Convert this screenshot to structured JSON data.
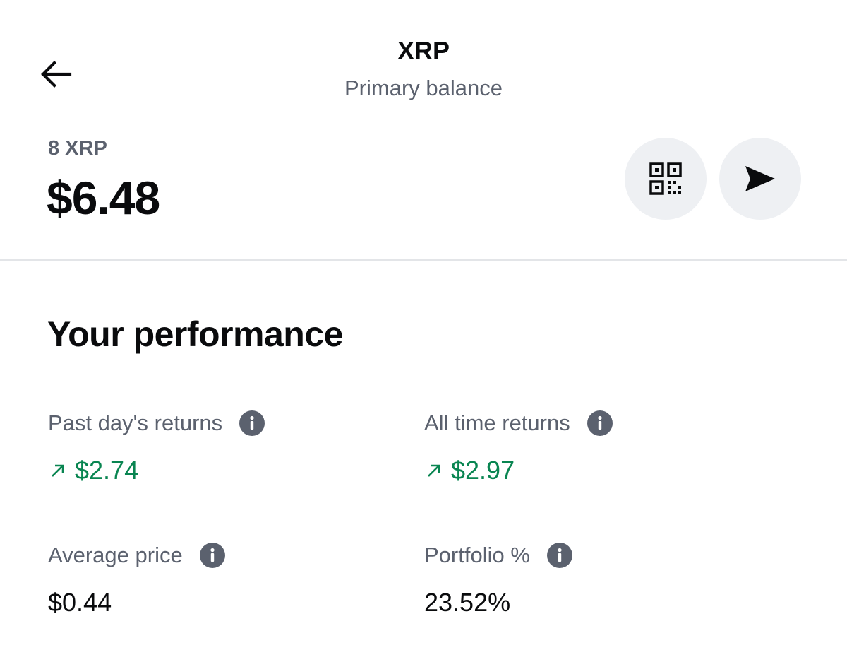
{
  "header": {
    "title": "XRP",
    "subtitle": "Primary balance",
    "back_icon": "arrow-left-icon"
  },
  "balance": {
    "crypto_amount": "8 XRP",
    "fiat_amount": "$6.48",
    "receive_icon": "qr-code-icon",
    "send_icon": "send-arrow-icon"
  },
  "performance": {
    "title": "Your performance",
    "past_day": {
      "label": "Past day's returns",
      "value": "$2.74",
      "trend": "up"
    },
    "all_time": {
      "label": "All time returns",
      "value": "$2.97",
      "trend": "up"
    },
    "average_price": {
      "label": "Average price",
      "value": "$0.44"
    },
    "portfolio": {
      "label": "Portfolio %",
      "value": "23.52%"
    }
  },
  "colors": {
    "positive": "#098551",
    "muted": "#5b616e",
    "button_bg": "#eef0f3",
    "text": "#0a0b0d"
  }
}
